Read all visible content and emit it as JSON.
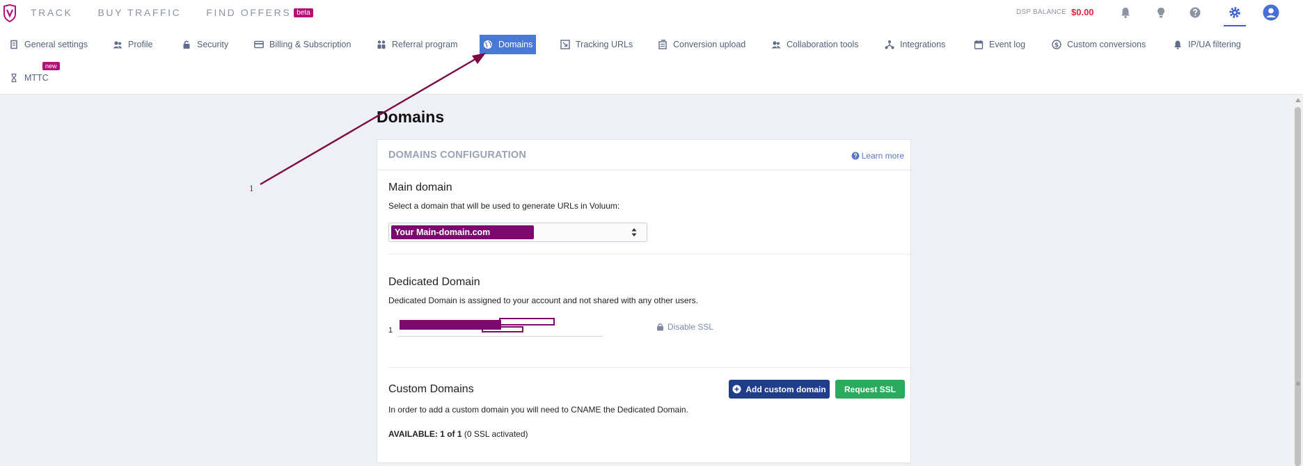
{
  "topnav": {
    "items": [
      "TRACK",
      "BUY TRAFFIC",
      "FIND OFFERS"
    ],
    "beta_badge": "beta",
    "dsp_label": "DSP BALANCE",
    "dsp_value": "$0.00"
  },
  "subnav": {
    "tabs": [
      {
        "label": "General settings",
        "icon": "general-settings-icon"
      },
      {
        "label": "Profile",
        "icon": "profile-icon"
      },
      {
        "label": "Security",
        "icon": "lock-icon"
      },
      {
        "label": "Billing & Subscription",
        "icon": "credit-card-icon"
      },
      {
        "label": "Referral program",
        "icon": "referral-icon"
      },
      {
        "label": "Domains",
        "icon": "globe-icon",
        "active": true
      },
      {
        "label": "Tracking URLs",
        "icon": "tracking-urls-icon"
      },
      {
        "label": "Conversion upload",
        "icon": "conversion-upload-icon"
      },
      {
        "label": "Collaboration tools",
        "icon": "collaboration-icon"
      },
      {
        "label": "Integrations",
        "icon": "integrations-icon"
      },
      {
        "label": "Event log",
        "icon": "calendar-icon"
      },
      {
        "label": "Custom conversions",
        "icon": "dollar-icon"
      },
      {
        "label": "IP/UA filtering",
        "icon": "bell-filter-icon"
      },
      {
        "label": "MTTC",
        "icon": "hourglass-icon"
      }
    ],
    "new_badge": "new"
  },
  "page": {
    "title": "Domains",
    "card_title": "DOMAINS CONFIGURATION",
    "learn_more": "Learn more",
    "main_domain": {
      "title": "Main domain",
      "desc": "Select a domain that will be used to generate URLs in Voluum:",
      "selected": "Your Main-domain.com"
    },
    "dedicated_domain": {
      "title": "Dedicated Domain",
      "desc": "Dedicated Domain is assigned to your account and not shared with any other users.",
      "prefix": "1",
      "disable_ssl": "Disable SSL"
    },
    "custom_domains": {
      "title": "Custom Domains",
      "desc": "In order to add a custom domain you will need to CNAME the Dedicated Domain.",
      "add_button": "Add custom domain",
      "request_ssl_button": "Request SSL",
      "available_label": "AVAILABLE: 1 of 1",
      "available_note": "(0 SSL activated)"
    }
  },
  "annotation": {
    "label": "1",
    "color": "#7b0a45"
  },
  "colors": {
    "accent": "#4a78d6",
    "brand": "#b0127a",
    "danger": "#e0243b",
    "success": "#2aaa5d",
    "primary_button": "#1f3d8a"
  }
}
